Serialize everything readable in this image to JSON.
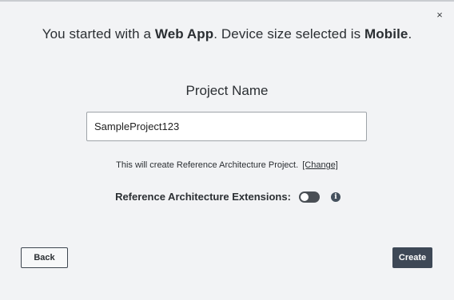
{
  "dialog": {
    "close_glyph": "×",
    "heading": {
      "prefix": "You started with a ",
      "app_type": "Web App",
      "middle": ". Device size selected is ",
      "device_size": "Mobile",
      "suffix": "."
    },
    "project_name_label": "Project Name",
    "project_name_value": "SampleProject123",
    "info_text": "This will create Reference Architecture Project.",
    "change_link": "[Change]",
    "extensions_label": "Reference Architecture Extensions:",
    "extensions_enabled": false,
    "info_icon_glyph": "i",
    "back_label": "Back",
    "create_label": "Create"
  },
  "icons": {
    "close": "close-icon",
    "info": "info-icon"
  },
  "colors": {
    "background": "#f2f3f5",
    "primary_button": "#3e4856",
    "toggle_off": "#4a4f55"
  }
}
